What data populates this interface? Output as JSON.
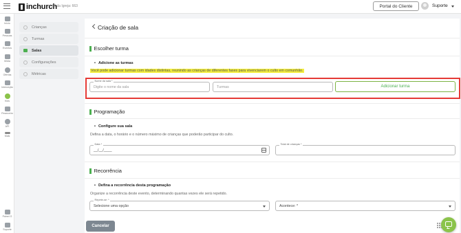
{
  "header": {
    "logo_text": "inchurch",
    "church_name": "ID da Igreja: 663",
    "portal_button": "Portal do Cliente",
    "user_name": "Suporte"
  },
  "leftnav": [
    {
      "label": "Início",
      "icon": "home-icon"
    },
    {
      "label": "Pessoas",
      "icon": "people-icon"
    },
    {
      "label": "Eventos",
      "icon": "calendar-icon"
    },
    {
      "label": "Mídia",
      "icon": "media-icon"
    },
    {
      "label": "Ofertas",
      "icon": "offer-icon"
    },
    {
      "label": "Interceção",
      "icon": "prayer-icon"
    },
    {
      "label": "Kids",
      "icon": "kids-icon"
    },
    {
      "label": "Financeiro",
      "icon": "finance-icon"
    },
    {
      "label": "API",
      "icon": "api-icon"
    },
    {
      "label": "Mais",
      "icon": "more-icon"
    },
    {
      "label": "Painel G",
      "icon": "grid-icon"
    },
    {
      "label": "Suporte",
      "icon": "support-icon"
    }
  ],
  "submenu": [
    {
      "label": "Crianças",
      "active": false
    },
    {
      "label": "Turmas",
      "active": false
    },
    {
      "label": "Salas",
      "active": true
    },
    {
      "label": "Configurações",
      "active": false
    },
    {
      "label": "Métricas",
      "active": false
    }
  ],
  "page": {
    "title": "Criação de sala"
  },
  "escolher_turma": {
    "title": "Escolher turma",
    "subtitle": "Adicione as turmas",
    "description": "Você pode adicionar turmas com idades distintas, reunindo as crianças de diferentes fases para vivenciarem o culto em comunhão.",
    "nome_label": "Nome da sala *",
    "nome_placeholder": "Digite o nome da sala",
    "turmas_placeholder": "Turmas",
    "add_button": "Adicionar turma"
  },
  "programacao": {
    "title": "Programação",
    "subtitle": "Configure sua sala",
    "description": "Defina a data, o horário e o número máximo de crianças que poderão participar do culto.",
    "data_label": "Data *",
    "data_value": "__/__/____",
    "total_label": "Total de crianças *"
  },
  "recorrencia": {
    "title": "Recorrência",
    "subtitle": "Defina a recorrência desta programação",
    "description": "Organize a recorrência deste evento, determinando quantas vezes ele será repetido.",
    "repete_label": "Repete-se: *",
    "repete_value": "Selecione uma opção",
    "acontece_value": "Acontece: *"
  },
  "footer": {
    "cancel_button": "Cancelar"
  },
  "colors": {
    "accent": "#4caf50",
    "highlight": "#f4ee3c",
    "red_outline": "#e53935"
  }
}
